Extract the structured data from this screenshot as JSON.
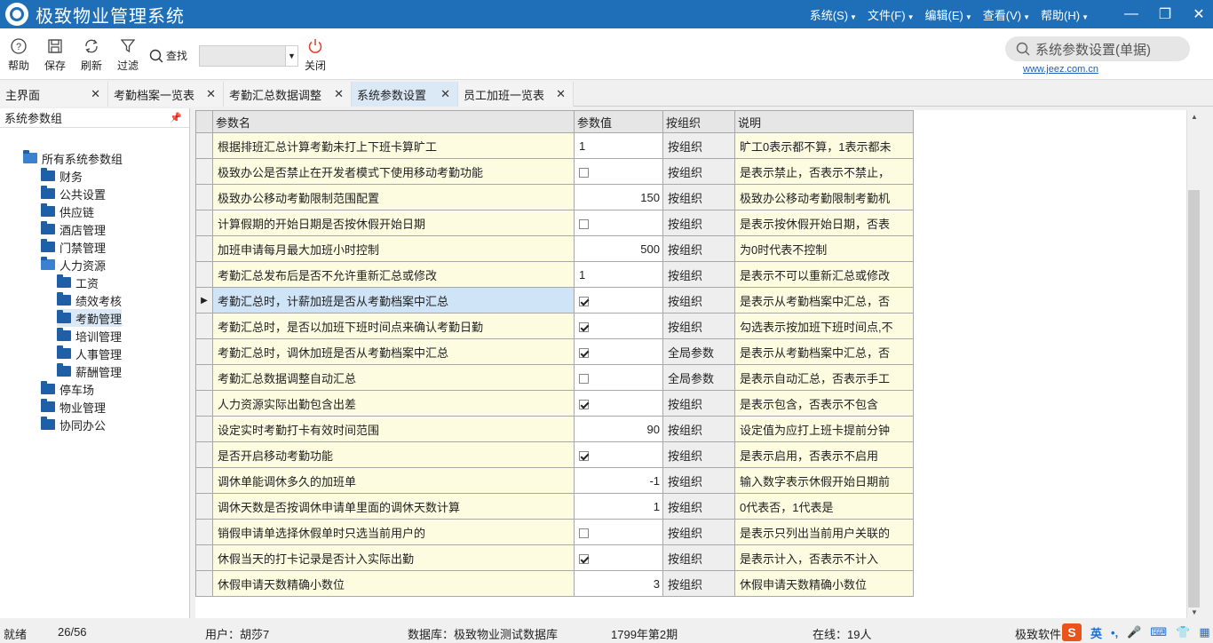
{
  "app": {
    "title": "极致物业管理系统"
  },
  "menu": [
    {
      "label": "系统(S)"
    },
    {
      "label": "文件(F)"
    },
    {
      "label": "编辑(E)"
    },
    {
      "label": "查看(V)"
    },
    {
      "label": "帮助(H)"
    }
  ],
  "toolbar": {
    "help": "帮助",
    "save": "保存",
    "refresh": "刷新",
    "filter": "过滤",
    "find": "查找",
    "find_value": "",
    "close": "关闭"
  },
  "search": {
    "text": "系统参数设置(单据)"
  },
  "weblink": "www.jeez.com.cn",
  "tabs": [
    {
      "label": "主界面"
    },
    {
      "label": "考勤档案一览表"
    },
    {
      "label": "考勤汇总数据调整"
    },
    {
      "label": "系统参数设置"
    },
    {
      "label": "员工加班一览表"
    }
  ],
  "panel": {
    "title": "系统参数组"
  },
  "tree": [
    {
      "label": "所有系统参数组"
    },
    {
      "label": "财务"
    },
    {
      "label": "公共设置"
    },
    {
      "label": "供应链"
    },
    {
      "label": "酒店管理"
    },
    {
      "label": "门禁管理"
    },
    {
      "label": "人力资源"
    },
    {
      "label": "工资"
    },
    {
      "label": "绩效考核"
    },
    {
      "label": "考勤管理"
    },
    {
      "label": "培训管理"
    },
    {
      "label": "人事管理"
    },
    {
      "label": "薪酬管理"
    },
    {
      "label": "停车场"
    },
    {
      "label": "物业管理"
    },
    {
      "label": "协同办公"
    }
  ],
  "grid": {
    "headers": {
      "name": "参数名",
      "value": "参数值",
      "org": "按组织",
      "desc": "说明"
    },
    "rows": [
      {
        "name": "根据排班汇总计算考勤未打上下班卡算旷工",
        "value": "1",
        "org": "按组织",
        "desc": "旷工0表示都不算，1表示都未"
      },
      {
        "name": "极致办公是否禁止在开发者模式下使用移动考勤功能",
        "value": "",
        "org": "按组织",
        "desc": "是表示禁止，否表示不禁止，"
      },
      {
        "name": "极致办公移动考勤限制范围配置",
        "value": "150",
        "org": "按组织",
        "desc": "极致办公移动考勤限制考勤机"
      },
      {
        "name": "计算假期的开始日期是否按休假开始日期",
        "value": "",
        "org": "按组织",
        "desc": "是表示按休假开始日期，否表"
      },
      {
        "name": "加班申请每月最大加班小时控制",
        "value": "500",
        "org": "按组织",
        "desc": "为0时代表不控制"
      },
      {
        "name": "考勤汇总发布后是否不允许重新汇总或修改",
        "value": "1",
        "org": "按组织",
        "desc": "是表示不可以重新汇总或修改"
      },
      {
        "name": "考勤汇总时，计薪加班是否从考勤档案中汇总",
        "value": "",
        "org": "按组织",
        "desc": "是表示从考勤档案中汇总，否"
      },
      {
        "name": "考勤汇总时，是否以加班下班时间点来确认考勤日勤",
        "value": "",
        "org": "按组织",
        "desc": "勾选表示按加班下班时间点,不"
      },
      {
        "name": "考勤汇总时，调休加班是否从考勤档案中汇总",
        "value": "",
        "org": "全局参数",
        "desc": "是表示从考勤档案中汇总，否"
      },
      {
        "name": "考勤汇总数据调整自动汇总",
        "value": "",
        "org": "全局参数",
        "desc": "是表示自动汇总，否表示手工"
      },
      {
        "name": "人力资源实际出勤包含出差",
        "value": "",
        "org": "按组织",
        "desc": "是表示包含，否表示不包含"
      },
      {
        "name": "设定实时考勤打卡有效时间范围",
        "value": "90",
        "org": "按组织",
        "desc": "设定值为应打上班卡提前分钟"
      },
      {
        "name": "是否开启移动考勤功能",
        "value": "",
        "org": "按组织",
        "desc": "是表示启用，否表示不启用"
      },
      {
        "name": "调休单能调休多久的加班单",
        "value": "-1",
        "org": "按组织",
        "desc": "输入数字表示休假开始日期前"
      },
      {
        "name": "调休天数是否按调休申请单里面的调休天数计算",
        "value": "1",
        "org": "按组织",
        "desc": "0代表否，1代表是"
      },
      {
        "name": "销假申请单选择休假单时只选当前用户的",
        "value": "",
        "org": "按组织",
        "desc": "是表示只列出当前用户关联的"
      },
      {
        "name": "休假当天的打卡记录是否计入实际出勤",
        "value": "",
        "org": "按组织",
        "desc": "是表示计入，否表示不计入"
      },
      {
        "name": "休假申请天数精确小数位",
        "value": "3",
        "org": "按组织",
        "desc": "休假申请天数精确小数位"
      }
    ]
  },
  "checkboxes": [
    null,
    false,
    null,
    false,
    null,
    null,
    true,
    true,
    true,
    false,
    true,
    null,
    true,
    null,
    null,
    false,
    true,
    null
  ],
  "status": {
    "state": "就绪",
    "count": "26/56",
    "user": "用户：胡莎7",
    "db": "数据库：极致物业测试数据库",
    "period": "1799年第2期",
    "online": "在线：19人",
    "company": "极致软件"
  },
  "tray": {
    "sogou": "S",
    "lang": "英"
  }
}
